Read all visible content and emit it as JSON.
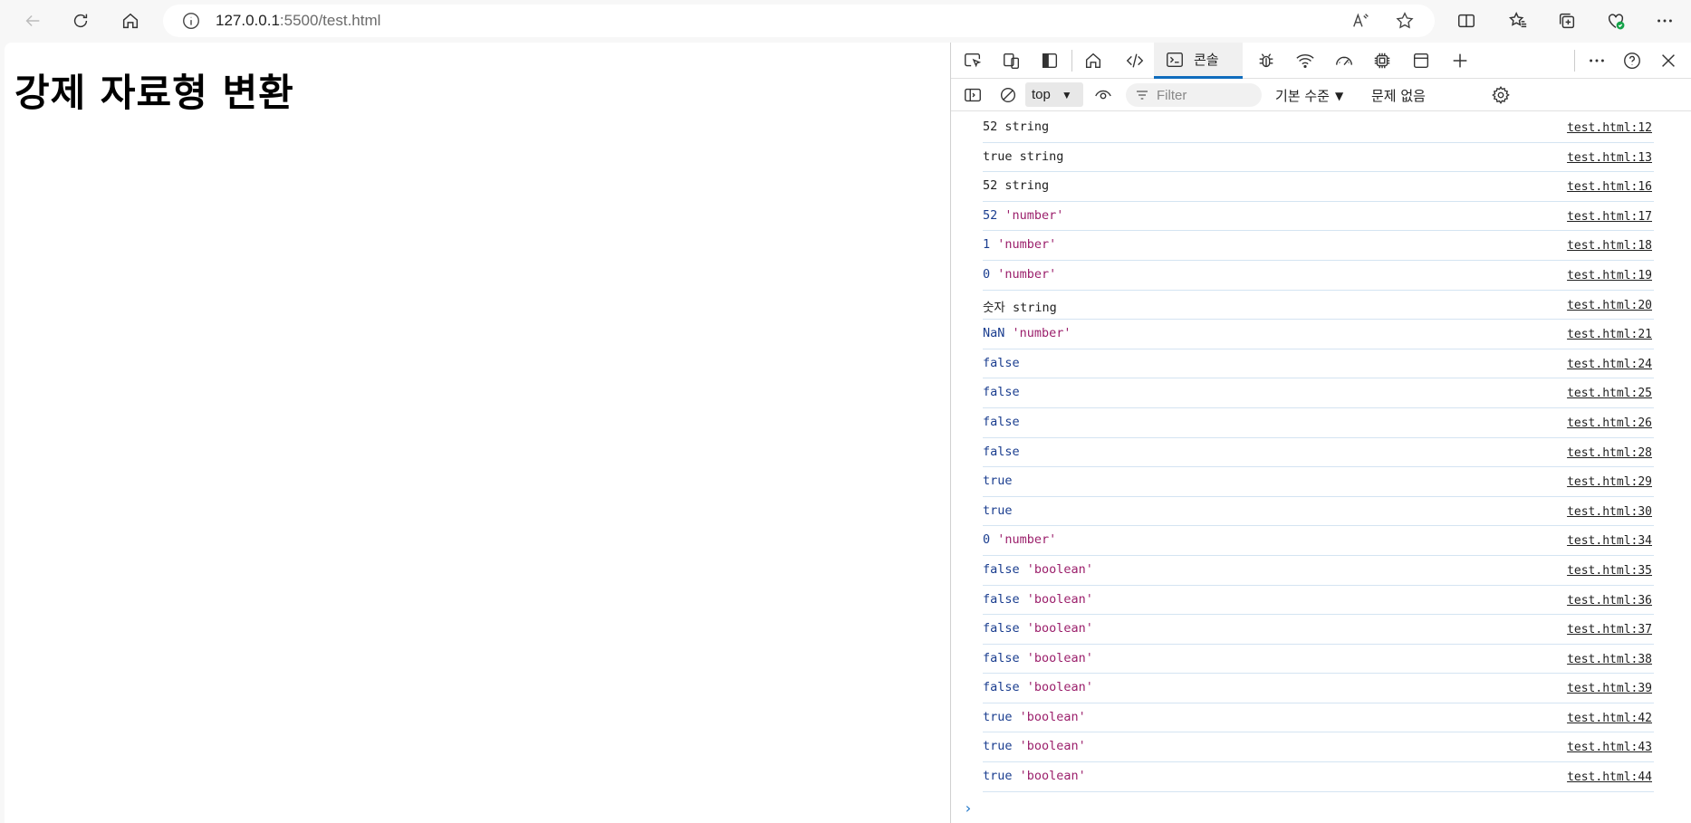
{
  "browser": {
    "url_host": "127.0.0.1",
    "url_rest": ":5500/test.html"
  },
  "page": {
    "title": "강제 자료형 변환"
  },
  "devtools": {
    "console_tab_label": "콘솔",
    "context": "top",
    "filter_placeholder": "Filter",
    "level_label": "기본 수준",
    "issues_label": "문제 없음",
    "logs": [
      {
        "value": "52",
        "type": "string",
        "quoted": false,
        "value_style": "plain",
        "source": "test.html:12"
      },
      {
        "value": "true",
        "type": "string",
        "quoted": false,
        "value_style": "plain",
        "source": "test.html:13"
      },
      {
        "value": "52",
        "type": "string",
        "quoted": false,
        "value_style": "plain",
        "source": "test.html:16"
      },
      {
        "value": "52",
        "type": "'number'",
        "quoted": true,
        "value_style": "num",
        "source": "test.html:17"
      },
      {
        "value": "1",
        "type": "'number'",
        "quoted": true,
        "value_style": "num",
        "source": "test.html:18"
      },
      {
        "value": "0",
        "type": "'number'",
        "quoted": true,
        "value_style": "num",
        "source": "test.html:19"
      },
      {
        "value": "숫자",
        "type": "string",
        "quoted": false,
        "value_style": "plain",
        "source": "test.html:20"
      },
      {
        "value": "NaN",
        "type": "'number'",
        "quoted": true,
        "value_style": "num",
        "source": "test.html:21"
      },
      {
        "value": "false",
        "type": "",
        "quoted": false,
        "value_style": "kw",
        "source": "test.html:24"
      },
      {
        "value": "false",
        "type": "",
        "quoted": false,
        "value_style": "kw",
        "source": "test.html:25"
      },
      {
        "value": "false",
        "type": "",
        "quoted": false,
        "value_style": "kw",
        "source": "test.html:26"
      },
      {
        "value": "false",
        "type": "",
        "quoted": false,
        "value_style": "kw",
        "source": "test.html:28"
      },
      {
        "value": "true",
        "type": "",
        "quoted": false,
        "value_style": "kw",
        "source": "test.html:29"
      },
      {
        "value": "true",
        "type": "",
        "quoted": false,
        "value_style": "kw",
        "source": "test.html:30"
      },
      {
        "value": "0",
        "type": "'number'",
        "quoted": true,
        "value_style": "num",
        "source": "test.html:34"
      },
      {
        "value": "false",
        "type": "'boolean'",
        "quoted": true,
        "value_style": "kw",
        "source": "test.html:35"
      },
      {
        "value": "false",
        "type": "'boolean'",
        "quoted": true,
        "value_style": "kw",
        "source": "test.html:36"
      },
      {
        "value": "false",
        "type": "'boolean'",
        "quoted": true,
        "value_style": "kw",
        "source": "test.html:37"
      },
      {
        "value": "false",
        "type": "'boolean'",
        "quoted": true,
        "value_style": "kw",
        "source": "test.html:38"
      },
      {
        "value": "false",
        "type": "'boolean'",
        "quoted": true,
        "value_style": "kw",
        "source": "test.html:39"
      },
      {
        "value": "true",
        "type": "'boolean'",
        "quoted": true,
        "value_style": "kw",
        "source": "test.html:42"
      },
      {
        "value": "true",
        "type": "'boolean'",
        "quoted": true,
        "value_style": "kw",
        "source": "test.html:43"
      },
      {
        "value": "true",
        "type": "'boolean'",
        "quoted": true,
        "value_style": "kw",
        "source": "test.html:44"
      }
    ],
    "prompt_symbol": "›"
  },
  "colors": {
    "accent": "#0f6cbd",
    "number_value": "#1a3d8f",
    "quoted_type": "#9b1f6b",
    "row_border": "#d4e4f2"
  },
  "icons": {
    "toolbar": [
      "back-arrow-icon",
      "refresh-icon",
      "home-icon",
      "info-icon",
      "read-aloud-icon",
      "favorite-star-icon",
      "split-screen-icon",
      "favorites-icon",
      "collections-icon",
      "browser-essentials-icon",
      "more-icon"
    ],
    "devtools": [
      "inspect-icon",
      "device-emulation-icon",
      "dock-icon",
      "welcome-home-icon",
      "elements-icon",
      "console-icon",
      "sources-bug-icon",
      "network-wifi-icon",
      "performance-icon",
      "memory-chip-icon",
      "application-icon",
      "add-tab-icon",
      "more-tools-icon",
      "help-icon",
      "close-icon"
    ]
  }
}
